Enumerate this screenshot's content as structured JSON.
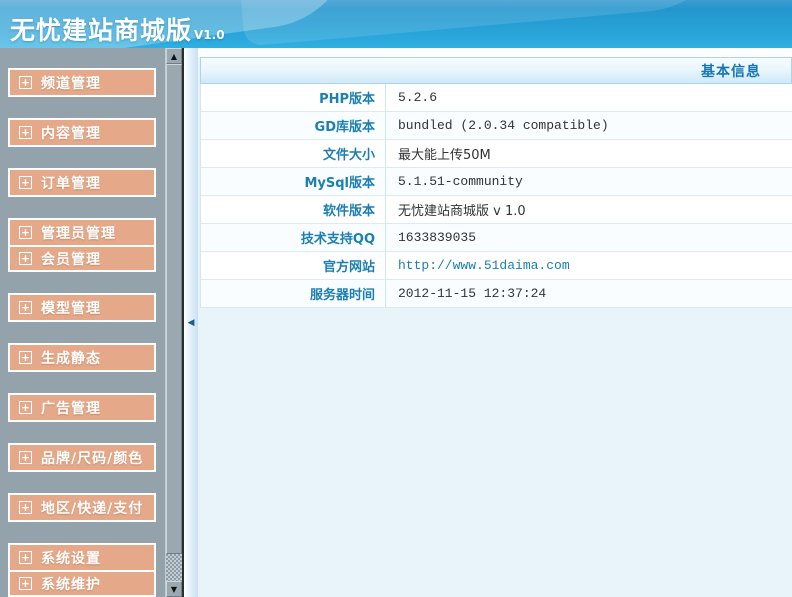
{
  "header": {
    "title": "无忧建站商城版",
    "version": "V1.0"
  },
  "icons": {
    "expand": "+",
    "scroll_up": "▲",
    "scroll_down": "▼",
    "collapse": "◀"
  },
  "sidebar": {
    "groups": [
      {
        "items": [
          "频道管理"
        ]
      },
      {
        "items": [
          "内容管理"
        ]
      },
      {
        "items": [
          "订单管理"
        ]
      },
      {
        "items": [
          "管理员管理",
          "会员管理"
        ]
      },
      {
        "items": [
          "模型管理"
        ]
      },
      {
        "items": [
          "生成静态"
        ]
      },
      {
        "items": [
          "广告管理"
        ]
      },
      {
        "items": [
          "品牌/尺码/颜色"
        ]
      },
      {
        "items": [
          "地区/快递/支付"
        ]
      },
      {
        "items": [
          "系统设置",
          "系统维护"
        ]
      }
    ]
  },
  "info_panel": {
    "title": "基本信息",
    "rows": [
      {
        "label": "PHP版本",
        "value": "5.2.6"
      },
      {
        "label": "GD库版本",
        "value": "bundled (2.0.34 compatible)"
      },
      {
        "label": "文件大小",
        "value": "最大能上传50M"
      },
      {
        "label": "MySql版本",
        "value": "5.1.51-community"
      },
      {
        "label": "软件版本",
        "value": "无忧建站商城版 v 1.0"
      },
      {
        "label": "技术支持QQ",
        "value": "1633839035"
      },
      {
        "label": "官方网站",
        "value": "http://www.51daima.com"
      },
      {
        "label": "服务器时间",
        "value": "2012-11-15 12:37:24"
      }
    ]
  },
  "colors": {
    "header_top": "#2496cd",
    "header_bottom": "#2fb0e2",
    "sidebar_bg": "#94a3ab",
    "nav_button_bg": "#e5a888",
    "panel_label": "#1b7fb2",
    "panel_title": "#1576b8",
    "link": "#1b7fb2",
    "content_bg": "#e9f3fa"
  }
}
